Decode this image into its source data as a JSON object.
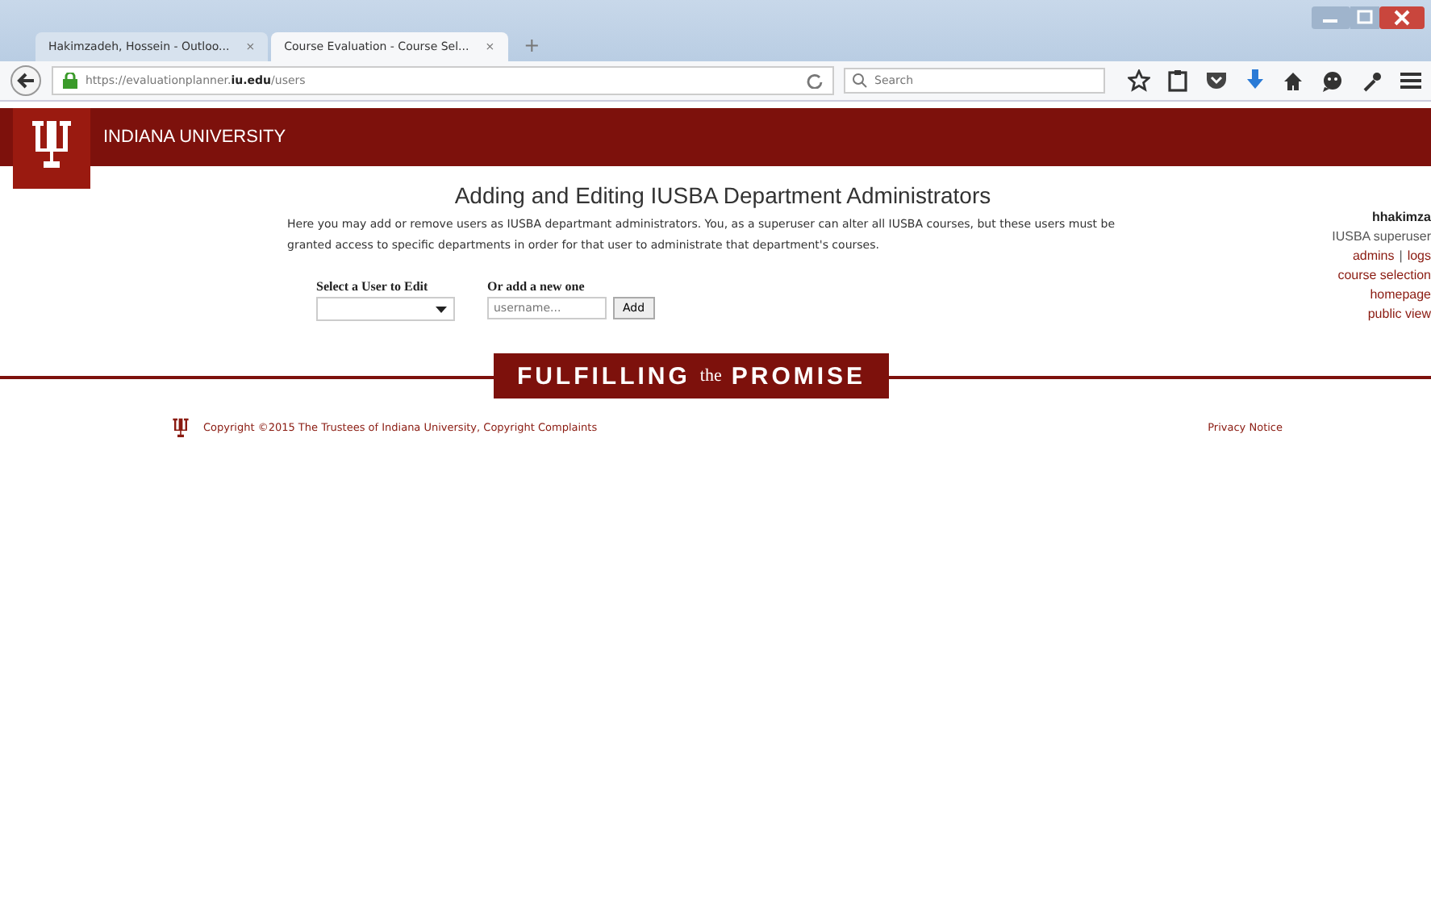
{
  "browser": {
    "tabs": [
      {
        "label": "Hakimzadeh, Hossein - Outloo...",
        "selected": false
      },
      {
        "label": "Course Evaluation - Course Sel...",
        "selected": true
      }
    ],
    "new_tab": "+",
    "close": "×",
    "url": "https://evaluationplanner.**iu.edu**/users",
    "search": {
      "placeholder": "Search"
    }
  },
  "header": {
    "title": "INDIANA UNIVERSITY"
  },
  "main": {
    "heading": "Adding and Editing IUSBA Department Administrators",
    "intro": "Here you may add or remove users as IUSBA departmant administrators. You, as a superuser can alter all IUSBA courses, but these users must be granted access to specific departments in order for that user to administrate that department's courses.",
    "select_label": "Select a User to Edit",
    "add_label": "Or add a new one",
    "add_field": {
      "placeholder": "username..."
    },
    "add_button": "Add"
  },
  "user_panel": {
    "username": "hhakimza",
    "role": "IUSBA superuser",
    "separator": "|",
    "links": [
      [
        "admins",
        "logs"
      ],
      [
        "course selection"
      ],
      [
        "homepage"
      ],
      [
        "public view"
      ]
    ]
  },
  "banner": [
    {
      "text": "FULFILLING",
      "kind": "big"
    },
    {
      "text": "the",
      "kind": "small"
    },
    {
      "text": "PROMISE",
      "kind": "big"
    }
  ],
  "footer": {
    "copyright": "Copyright ©2015 The Trustees of Indiana University, ",
    "complaints_link": "Copyright Complaints",
    "privacy_link": "Privacy Notice"
  }
}
